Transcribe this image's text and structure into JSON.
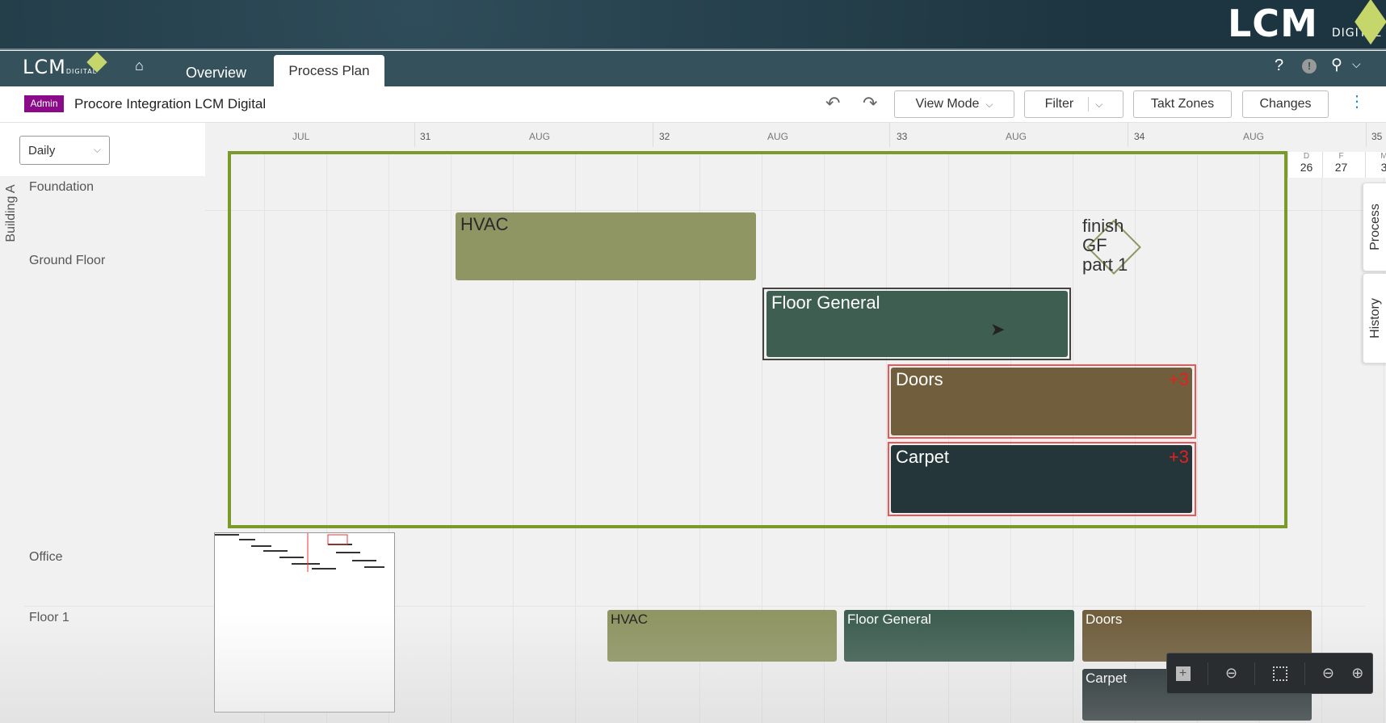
{
  "brand": {
    "name": "LCM",
    "sub": "DIGITAL"
  },
  "nav": {
    "tabs": [
      {
        "label": "Overview"
      },
      {
        "label": "Process Plan",
        "active": true
      }
    ],
    "icons": [
      "home-icon",
      "help-icon",
      "alert-icon",
      "user-icon",
      "chevron-down-icon"
    ]
  },
  "subheader": {
    "badge": "Admin",
    "project": "Procore Integration LCM Digital",
    "view_mode": "View Mode",
    "filter": "Filter",
    "takt_zones": "Takt Zones",
    "changes": "Changes"
  },
  "scale_select": {
    "value": "Daily"
  },
  "timeline": {
    "headers": [
      {
        "label": "JUL",
        "type": "month"
      },
      {
        "label": "31",
        "type": "week"
      },
      {
        "label": "AUG",
        "type": "month"
      },
      {
        "label": "32",
        "type": "week"
      },
      {
        "label": "AUG",
        "type": "month"
      },
      {
        "label": "33",
        "type": "week"
      },
      {
        "label": "AUG",
        "type": "month"
      },
      {
        "label": "34",
        "type": "week"
      },
      {
        "label": "AUG",
        "type": "month"
      },
      {
        "label": "35",
        "type": "week"
      }
    ],
    "days": [
      {
        "dow": "D",
        "num": "26"
      },
      {
        "dow": "F",
        "num": "27"
      },
      {
        "dow": "M",
        "num": "3"
      }
    ]
  },
  "group": "Building A",
  "rows": [
    {
      "label": "Foundation"
    },
    {
      "label": "Ground Floor"
    },
    {
      "label": "Office"
    },
    {
      "label": "Floor 1"
    }
  ],
  "tasks": [
    {
      "label": "HVAC",
      "color": "#8f9663"
    },
    {
      "label": "Floor General",
      "color": "#3d5e50",
      "selected": true
    },
    {
      "label": "Doors",
      "color": "#705e3c",
      "badge": "+3",
      "conflict": true
    },
    {
      "label": "Carpet",
      "color": "#25363a",
      "badge": "+3",
      "conflict": true
    }
  ],
  "milestone": {
    "label": "finish GF part 1"
  },
  "floor1_tasks": [
    {
      "label": "HVAC",
      "color": "#8f9663"
    },
    {
      "label": "Floor General",
      "color": "#3d5e50"
    },
    {
      "label": "Doors",
      "color": "#705e3c"
    },
    {
      "label": "Carpet",
      "color": "#1e2a2c"
    }
  ],
  "side_tabs": [
    {
      "label": "Process"
    },
    {
      "label": "History"
    }
  ],
  "colors": {
    "frame": "#7a9a2c",
    "conflict": "#e62020",
    "nav": "#35525c",
    "badge": "#8a0a8a"
  }
}
